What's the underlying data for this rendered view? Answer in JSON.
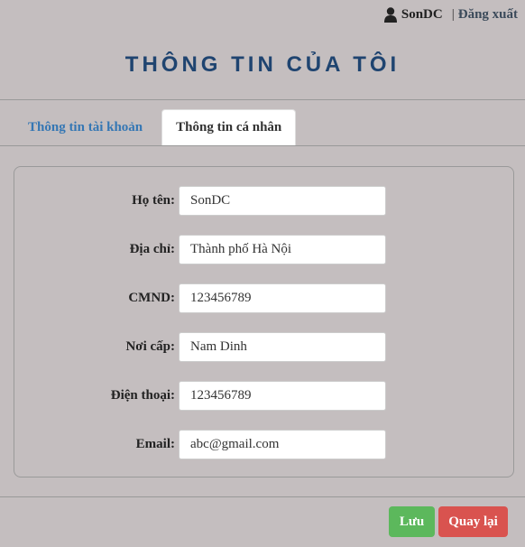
{
  "header": {
    "username": "SonDC",
    "separator": "|",
    "logout_label": "Đăng xuất",
    "title": "THÔNG TIN CỦA TÔI"
  },
  "tabs": [
    {
      "label": "Thông tin tài khoản",
      "active": false
    },
    {
      "label": "Thông tin cá nhân",
      "active": true
    }
  ],
  "form": {
    "fields": [
      {
        "label": "Họ tên:",
        "value": "SonDC"
      },
      {
        "label": "Địa chỉ:",
        "value": "Thành phố Hà Nội"
      },
      {
        "label": "CMND:",
        "value": "123456789"
      },
      {
        "label": "Nơi cấp:",
        "value": "Nam Dinh"
      },
      {
        "label": "Điện thoại:",
        "value": "123456789"
      },
      {
        "label": "Email:",
        "value": "abc@gmail.com"
      }
    ]
  },
  "actions": {
    "save_label": "Lưu",
    "back_label": "Quay lại"
  },
  "colors": {
    "background": "#c4bebf",
    "title": "#1f4470",
    "tab_link": "#3577b4",
    "save": "#5cb85c",
    "back": "#d9534f"
  },
  "icons": {
    "user": "user-icon"
  }
}
